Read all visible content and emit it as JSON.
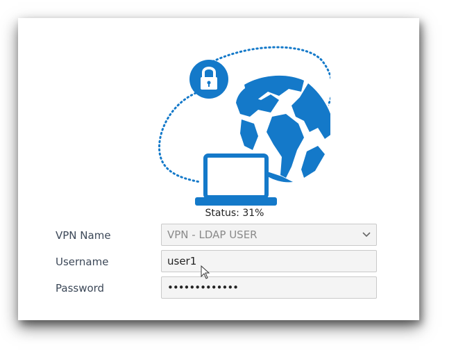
{
  "status": {
    "text": "Status: 31%",
    "progress_percent": 31
  },
  "form": {
    "vpn_name": {
      "label": "VPN Name",
      "selected": "VPN - LDAP USER"
    },
    "username": {
      "label": "Username",
      "value": "user1"
    },
    "password": {
      "label": "Password",
      "masked_value": "•••••••••••••"
    }
  },
  "icons": {
    "lock": "lock-icon",
    "globe": "globe-icon",
    "laptop": "laptop-icon",
    "dropdown": "chevron-down-icon",
    "cursor": "mouse-cursor-icon"
  },
  "colors": {
    "accent": "#1479c9"
  }
}
